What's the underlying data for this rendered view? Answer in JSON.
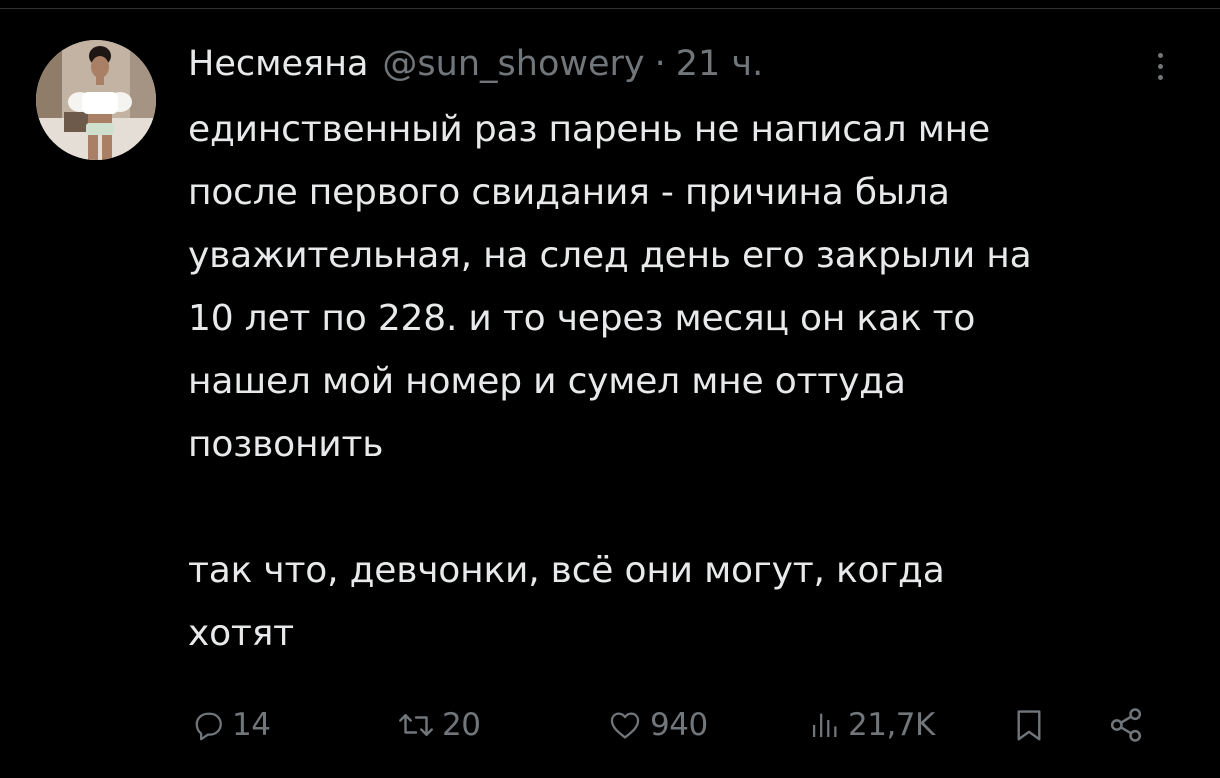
{
  "tweet": {
    "author": {
      "display_name": "Несмеяна",
      "handle": "@sun_showery",
      "separator": "·",
      "time": "21 ч."
    },
    "paragraphs": [
      "единственный раз парень не написал мне\nпосле первого свидания - причина была\nуважительная, на след день его закрыли на\n10 лет по 228. и то через месяц он как то\nнашел мой номер и сумел мне оттуда\nпозвонить",
      "так что, девчонки, всё они могут, когда\nхотят"
    ],
    "actions": {
      "replies": "14",
      "reposts": "20",
      "likes": "940",
      "views": "21,7K"
    }
  },
  "colors": {
    "background": "#000000",
    "text": "#e7e9ea",
    "secondary_text": "#71767b",
    "divider": "#2f3336"
  },
  "icons": [
    "more-icon",
    "reply-icon",
    "repost-icon",
    "like-icon",
    "views-icon",
    "bookmark-icon",
    "share-icon"
  ]
}
